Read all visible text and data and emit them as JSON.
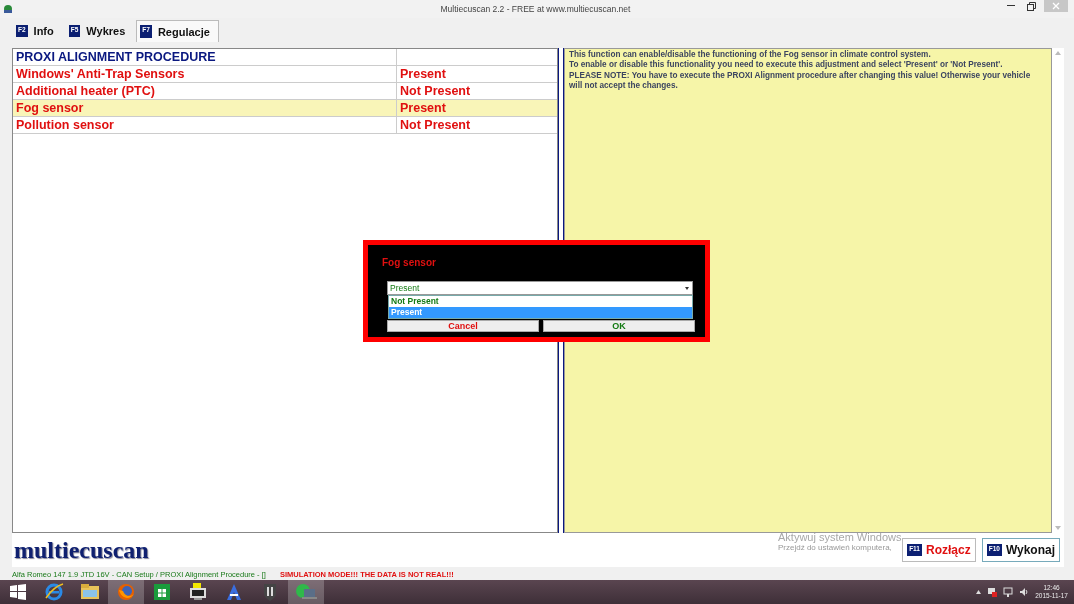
{
  "window": {
    "title": "Multiecuscan 2.2 - FREE at www.multiecuscan.net"
  },
  "tabs": [
    {
      "key": "F2",
      "label": "Info",
      "selected": false
    },
    {
      "key": "F5",
      "label": "Wykres",
      "selected": false
    },
    {
      "key": "F7",
      "label": "Regulacje",
      "selected": true
    }
  ],
  "table": {
    "rows": [
      {
        "kind": "header",
        "name": "PROXI ALIGNMENT PROCEDURE",
        "selected": false
      },
      {
        "kind": "item",
        "name": "Windows' Anti-Trap Sensors",
        "value": "Present",
        "selected": false
      },
      {
        "kind": "item",
        "name": "Additional heater (PTC)",
        "value": "Not Present",
        "selected": false
      },
      {
        "kind": "item",
        "name": "Fog sensor",
        "value": "Present",
        "selected": true
      },
      {
        "kind": "item",
        "name": "Pollution sensor",
        "value": "Not Present",
        "selected": false
      }
    ]
  },
  "description": [
    "This function can enable/disable the functioning of the Fog sensor in climate control system.",
    "To enable or disable this functionality you need to execute this adjustment and select 'Present' or 'Not Present'.",
    "PLEASE NOTE: You have to execute the PROXI Alignment procedure after changing this value! Otherwise your vehicle will not accept the changes."
  ],
  "dialog": {
    "title": "Fog sensor",
    "value": "Present",
    "options": [
      {
        "label": "Not Present",
        "selected": false
      },
      {
        "label": "Present",
        "selected": true
      }
    ],
    "buttons": [
      {
        "kind": "cancel",
        "label": "Cancel"
      },
      {
        "kind": "ok",
        "label": "OK"
      }
    ]
  },
  "logo": "multiecuscan",
  "activation": {
    "title": "Aktywuj system Windows",
    "hint": "Przejdź do ustawień komputera,"
  },
  "actions": [
    {
      "kind": "disconnect",
      "key": "F11",
      "label": "Rozłącz"
    },
    {
      "kind": "execute",
      "key": "F10",
      "label": "Wykonaj"
    }
  ],
  "status": {
    "vehicle": "Alfa Romeo 147 1.9 JTD 16V - CAN Setup / PROXI Alignment Procedure - []",
    "warning": "SIMULATION MODE!!! THE DATA IS NOT REAL!!!"
  },
  "taskbar": {
    "apps": [
      {
        "kind": "start",
        "active": false
      },
      {
        "kind": "ie",
        "active": false
      },
      {
        "kind": "explorer",
        "active": false
      },
      {
        "kind": "firefox",
        "active": true
      },
      {
        "kind": "store",
        "active": false
      },
      {
        "kind": "monitor",
        "active": false
      },
      {
        "kind": "letter",
        "active": false
      },
      {
        "kind": "tank",
        "active": false
      },
      {
        "kind": "app",
        "active": true
      }
    ],
    "time": "12:46",
    "date": "2015-11-17"
  }
}
